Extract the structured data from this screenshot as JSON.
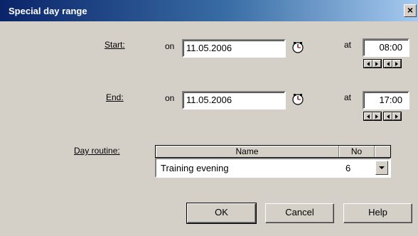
{
  "window": {
    "title": "Special day range",
    "close_glyph": "×"
  },
  "start": {
    "label": "Start:",
    "on_label": "on",
    "date": "11.05.2006",
    "at_label": "at",
    "time": "08:00"
  },
  "end": {
    "label": "End:",
    "on_label": "on",
    "date": "11.05.2006",
    "at_label": "at",
    "time": "17:00"
  },
  "day_routine": {
    "label": "Day routine:",
    "columns": [
      "Name",
      "No"
    ],
    "selected": {
      "name": "Training evening",
      "no": "6"
    }
  },
  "buttons": {
    "ok": "OK",
    "cancel": "Cancel",
    "help": "Help"
  },
  "icons": {
    "calendar": "calendar-icon",
    "spin_left": "arrow-left-icon",
    "spin_right": "arrow-right-icon",
    "dropdown": "chevron-down-icon",
    "close": "close-icon"
  }
}
